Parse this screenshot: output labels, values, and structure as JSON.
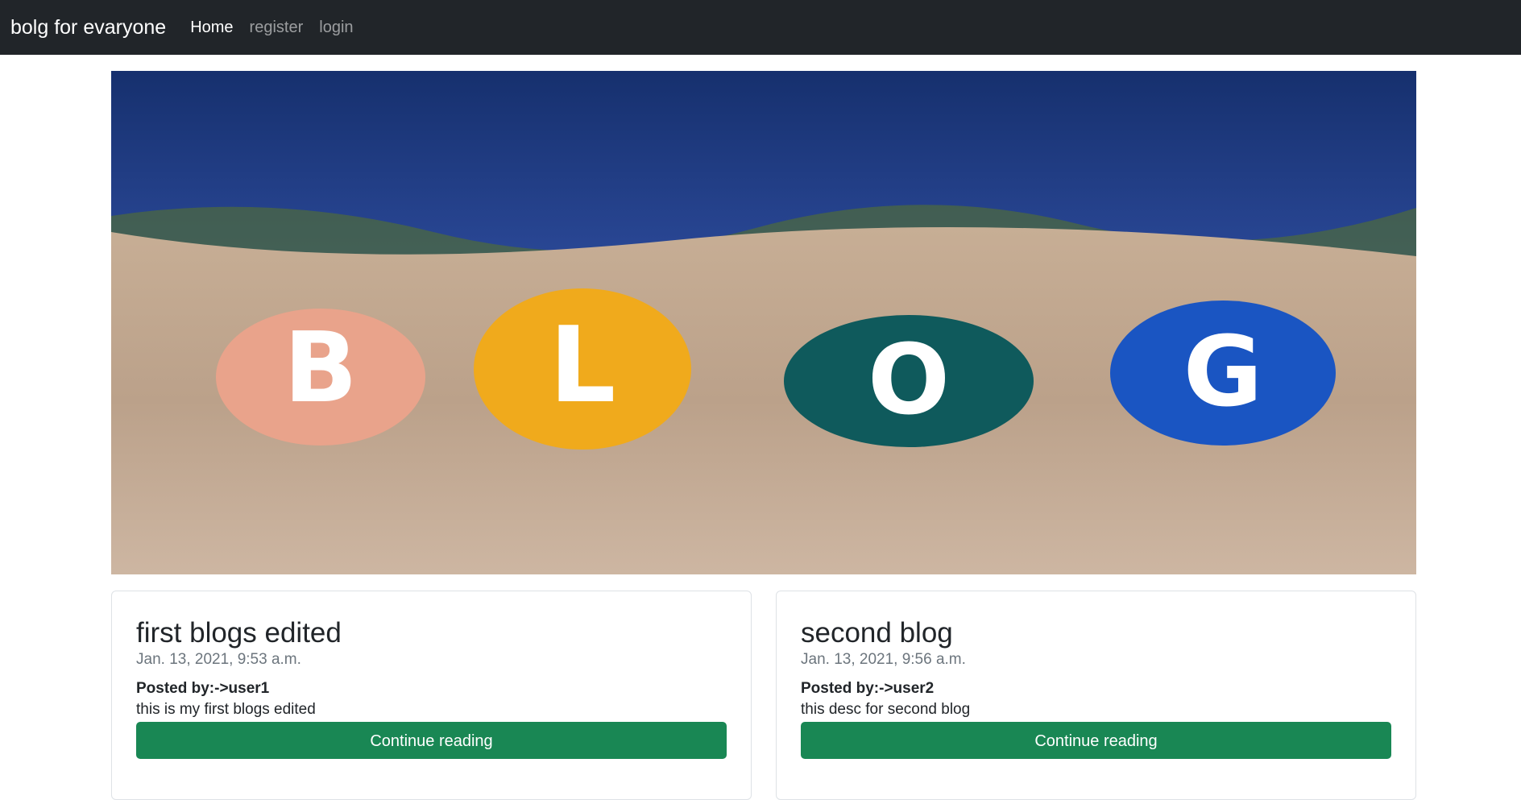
{
  "navbar": {
    "brand": "bolg for evaryone",
    "links": [
      {
        "label": "Home",
        "active": true
      },
      {
        "label": "register",
        "active": false
      },
      {
        "label": "login",
        "active": false
      }
    ]
  },
  "hero": {
    "stones": [
      {
        "letter": "B",
        "color": "#e9a38b"
      },
      {
        "letter": "L",
        "color": "#f0aa1c"
      },
      {
        "letter": "O",
        "color": "#0f5a5c"
      },
      {
        "letter": "G",
        "color": "#1a55c2"
      }
    ],
    "sky_color": "#1e3a8a",
    "sand_color": "#c9b097"
  },
  "posts": [
    {
      "title": "first blogs edited",
      "date": "Jan. 13, 2021, 9:53 a.m.",
      "author": "Posted by:->user1",
      "desc": "this is my first blogs edited",
      "button": "Continue reading"
    },
    {
      "title": "second blog",
      "date": "Jan. 13, 2021, 9:56 a.m.",
      "author": "Posted by:->user2",
      "desc": "this desc for second blog",
      "button": "Continue reading"
    }
  ]
}
